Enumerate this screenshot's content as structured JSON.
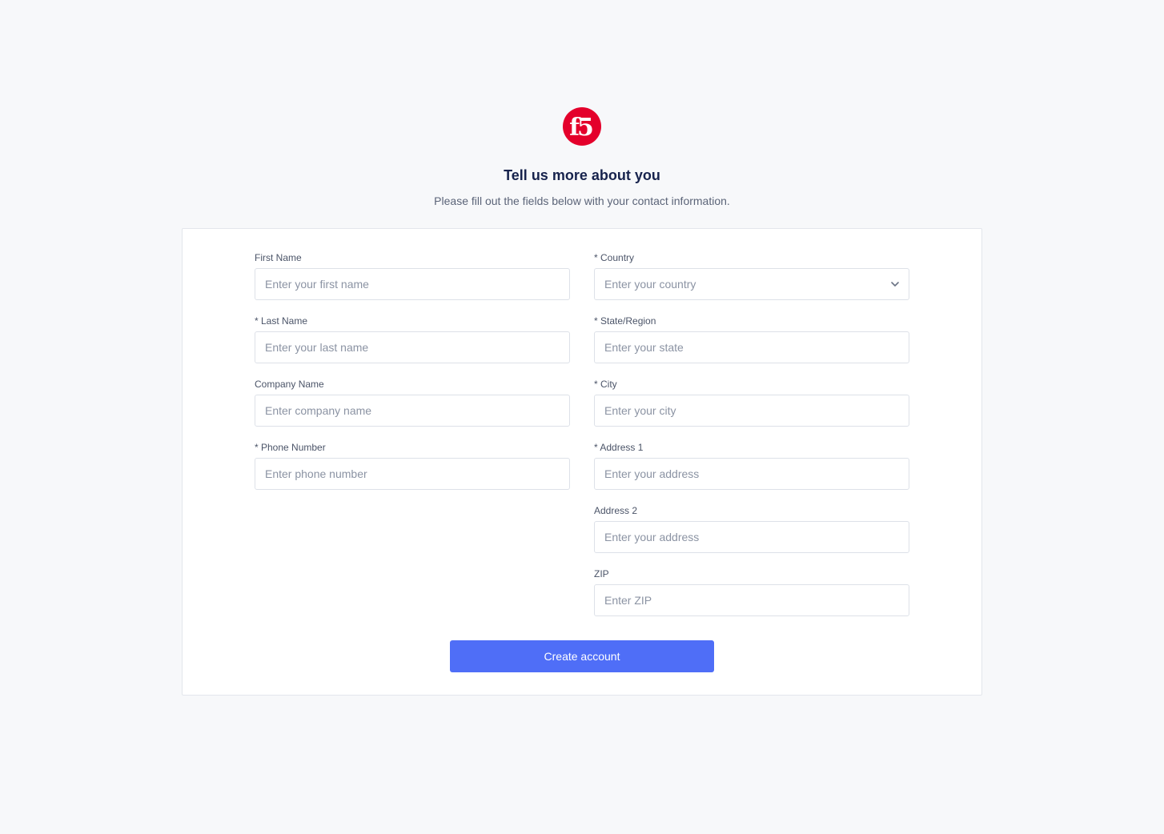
{
  "brand": {
    "logo_text": "f5",
    "logo_color": "#e4002b",
    "accent": "#4f6ef7"
  },
  "header": {
    "title": "Tell us more about you",
    "subtitle": "Please fill out the fields below with your contact information."
  },
  "form": {
    "first_name": {
      "label": "First Name",
      "placeholder": "Enter your first name"
    },
    "last_name": {
      "label": "* Last Name",
      "placeholder": "Enter your last name"
    },
    "company_name": {
      "label": "Company Name",
      "placeholder": "Enter company name"
    },
    "phone_number": {
      "label": "* Phone Number",
      "placeholder": "Enter phone number"
    },
    "country": {
      "label": "* Country",
      "placeholder": "Enter your country",
      "icon": "chevron-down-icon"
    },
    "state": {
      "label": "* State/Region",
      "placeholder": "Enter your state"
    },
    "city": {
      "label": "* City",
      "placeholder": "Enter your city"
    },
    "address1": {
      "label": "* Address 1",
      "placeholder": "Enter your address"
    },
    "address2": {
      "label": "Address 2",
      "placeholder": "Enter your address"
    },
    "zip": {
      "label": "ZIP",
      "placeholder": "Enter ZIP"
    },
    "submit_label": "Create account"
  }
}
